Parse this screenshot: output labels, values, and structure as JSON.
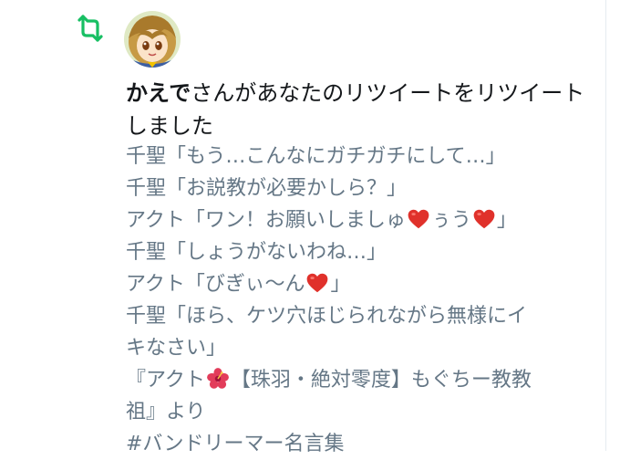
{
  "notification": {
    "type_icon": "retweet-icon",
    "accent_color": "#17bf63",
    "avatar_icon": "user-avatar",
    "user_name": "かえで",
    "action_text": "さんがあなたのリツイートをリツイートしました"
  },
  "tweet": {
    "text_color": "#657786",
    "lines": [
      {
        "parts": [
          "千聖「もう…こんなにガチガチにして…」"
        ]
      },
      {
        "parts": [
          "千聖「お説教が必要かしら？」"
        ]
      },
      {
        "parts": [
          "アクト「ワン！お願いしましゅ",
          "ぅう",
          "」"
        ],
        "emojis": [
          "heart",
          "heart"
        ]
      },
      {
        "parts": [
          "千聖「しょうがないわね…」"
        ]
      },
      {
        "parts": [
          "アクト「びぎぃ〜ん",
          "」"
        ],
        "emojis": [
          "heart"
        ]
      },
      {
        "parts": [
          "千聖「ほら、ケツ穴ほじられながら無様にイ"
        ]
      },
      {
        "parts": [
          "キなさい」"
        ]
      },
      {
        "parts": [
          "『アクト",
          "【珠羽・絶対零度】もぐちー教教"
        ],
        "emojis": [
          "hibiscus"
        ]
      },
      {
        "parts": [
          "祖』より"
        ]
      },
      {
        "parts": [
          "#バンドリーマー名言集"
        ]
      }
    ]
  }
}
